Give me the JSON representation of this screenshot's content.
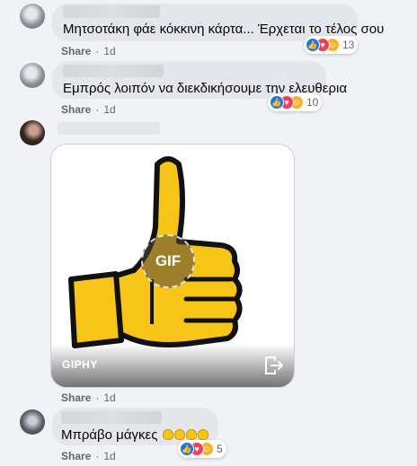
{
  "comments": [
    {
      "text": "Μητσοτάκη φάε κόκκινη κάρτα... Έρχεται το τέλος σου",
      "share_label": "Share",
      "time": "1d",
      "reaction_count": "13"
    },
    {
      "text": "Εμπρός λοιπόν να διεκδικήσουμε την ελευθερια",
      "share_label": "Share",
      "time": "1d",
      "reaction_count": "10"
    },
    {
      "gif_provider": "GIPHY",
      "gif_badge": "GIF",
      "share_label": "Share",
      "time": "1d"
    },
    {
      "text": "Μπράβο μάγκες",
      "share_label": "Share",
      "time": "1d",
      "reaction_count": "5"
    }
  ],
  "colors": {
    "background": "#f0f2f5",
    "bubble": "#e4e6eb",
    "like": "#1877f2",
    "love": "#f33e58",
    "care": "#f7b125",
    "meta_text": "#65676b"
  },
  "icons": [
    "like-reaction-icon",
    "love-reaction-icon",
    "care-reaction-icon",
    "thumbs-up-gif",
    "share-arrow-icon"
  ]
}
